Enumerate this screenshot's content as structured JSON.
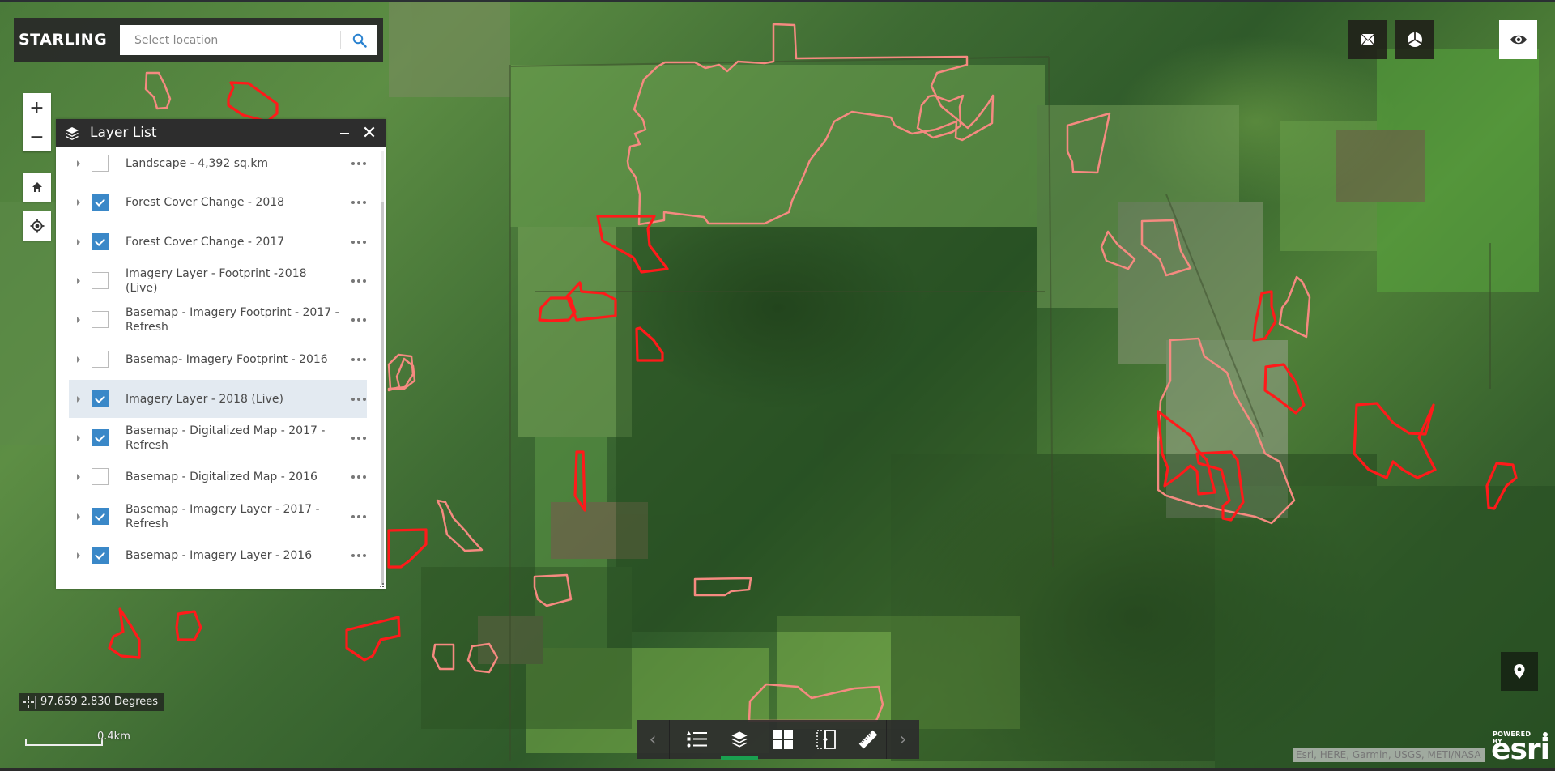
{
  "app": {
    "brand": "STARLING"
  },
  "search": {
    "placeholder": "Select location",
    "value": "",
    "icon": "search-icon"
  },
  "map_controls": {
    "zoom_in": "+",
    "zoom_out": "−",
    "home_icon": "home-icon",
    "locate_icon": "crosshair-icon"
  },
  "layer_list": {
    "title": "Layer List",
    "minimize_label": "minimize",
    "close_label": "✕",
    "layers": [
      {
        "label": "Landscape - 4,392 sq.km",
        "checked": false,
        "selected": false
      },
      {
        "label": "Forest Cover Change - 2018",
        "checked": true,
        "selected": false
      },
      {
        "label": "Forest Cover Change - 2017",
        "checked": true,
        "selected": false
      },
      {
        "label": "Imagery Layer - Footprint -2018 (Live)",
        "checked": false,
        "selected": false
      },
      {
        "label": "Basemap - Imagery Footprint - 2017 - Refresh",
        "checked": false,
        "selected": false
      },
      {
        "label": "Basemap- Imagery Footprint - 2016",
        "checked": false,
        "selected": false
      },
      {
        "label": "Imagery Layer - 2018 (Live)",
        "checked": true,
        "selected": true
      },
      {
        "label": "Basemap - Digitalized Map - 2017 - Refresh",
        "checked": true,
        "selected": false
      },
      {
        "label": "Basemap - Digitalized Map - 2016",
        "checked": false,
        "selected": false
      },
      {
        "label": "Basemap - Imagery Layer - 2017 - Refresh",
        "checked": true,
        "selected": false
      },
      {
        "label": "Basemap - Imagery Layer - 2016",
        "checked": true,
        "selected": false
      }
    ]
  },
  "top_right": {
    "buttons": [
      {
        "name": "mail-button",
        "icon": "envelope-icon"
      },
      {
        "name": "chart-button",
        "icon": "pie-chart-icon"
      },
      {
        "name": "visibility-button",
        "icon": "eye-icon"
      }
    ]
  },
  "coordinates": {
    "text": "97.659 2.830 Degrees"
  },
  "scale": {
    "label": "0.4km"
  },
  "toolbar": {
    "prev_label": "‹",
    "next_label": "›",
    "tools": [
      {
        "name": "legend",
        "icon": "list-icon",
        "active": false
      },
      {
        "name": "layers",
        "icon": "layers-icon",
        "active": true
      },
      {
        "name": "basemap-gallery",
        "icon": "grid-icon",
        "active": false
      },
      {
        "name": "swipe",
        "icon": "swipe-icon",
        "active": false
      },
      {
        "name": "measurement",
        "icon": "ruler-icon",
        "active": false
      }
    ],
    "active_color": "#1aa050"
  },
  "attribution": {
    "text": "Esri, HERE, Garmin, USGS, METI/NASA",
    "powered_by": "POWERED BY",
    "logo": "esri"
  },
  "colors": {
    "forest_change_2018": "#ff1a1a",
    "forest_change_2017": "#f58a80",
    "checkbox_on": "#3a88c8",
    "selected_row": "#e3eaf1"
  }
}
